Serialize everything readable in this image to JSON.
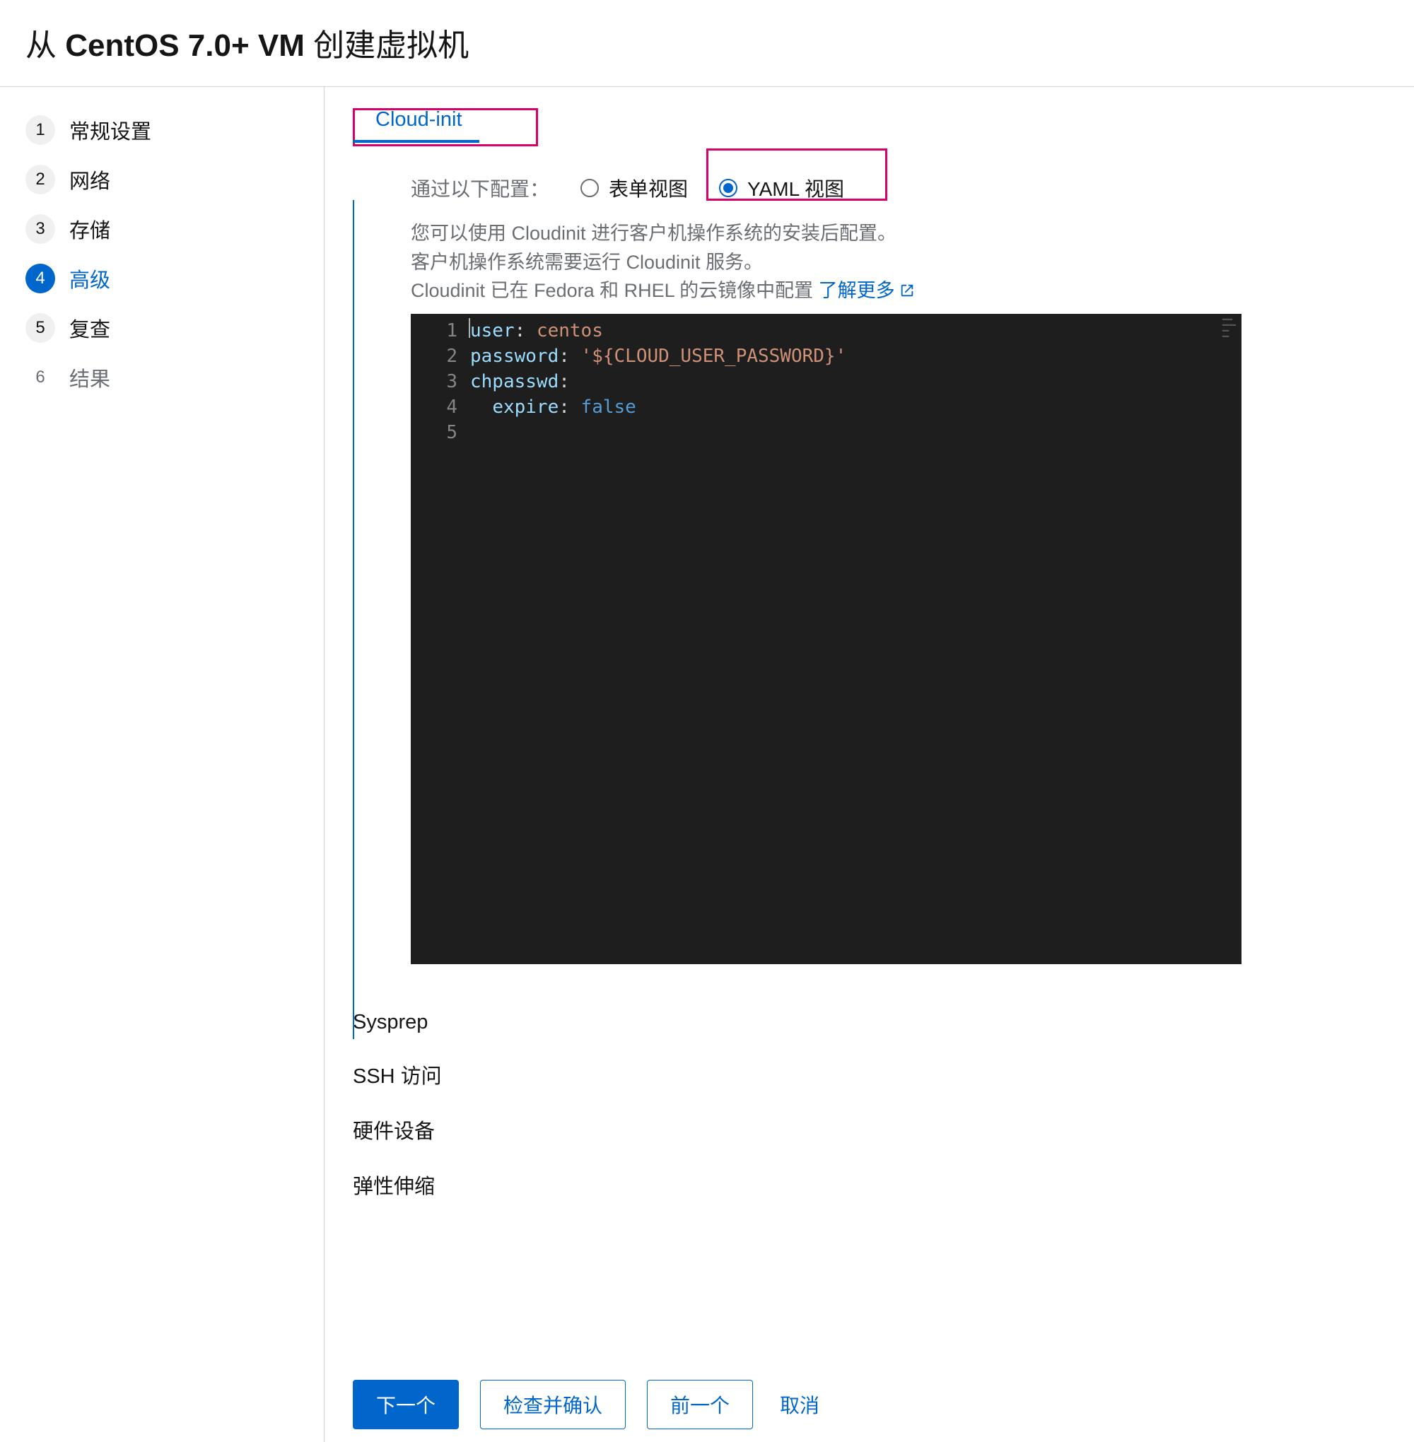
{
  "header": {
    "title_prefix": "从 ",
    "title_bold": "CentOS 7.0+ VM",
    "title_suffix": " 创建虚拟机"
  },
  "steps": [
    {
      "num": "1",
      "label": "常规设置",
      "state": "done"
    },
    {
      "num": "2",
      "label": "网络",
      "state": "done"
    },
    {
      "num": "3",
      "label": "存储",
      "state": "done"
    },
    {
      "num": "4",
      "label": "高级",
      "state": "active"
    },
    {
      "num": "5",
      "label": "复查",
      "state": "done"
    },
    {
      "num": "6",
      "label": "结果",
      "state": "future"
    }
  ],
  "tab": {
    "cloud_init": "Cloud-init"
  },
  "config": {
    "label": "通过以下配置：",
    "form_view": "表单视图",
    "yaml_view": "YAML 视图"
  },
  "description": {
    "line1": "您可以使用 Cloudinit 进行客户机操作系统的安装后配置。",
    "line2": "客户机操作系统需要运行 Cloudinit 服务。",
    "line3_prefix": "Cloudinit 已在 Fedora 和 RHEL 的云镜像中配置 ",
    "learn_more": "了解更多"
  },
  "editor": {
    "gutter": [
      "1",
      "2",
      "3",
      "4",
      "5"
    ],
    "lines": {
      "l1_key": "user",
      "l1_val": "centos",
      "l2_key": "password",
      "l2_val": "'${CLOUD_USER_PASSWORD}'",
      "l3_key": "chpasswd",
      "l4_key": "expire",
      "l4_val": "false"
    }
  },
  "sections": {
    "sysprep": "Sysprep",
    "ssh": "SSH 访问",
    "hardware": "硬件设备",
    "autoscale": "弹性伸缩"
  },
  "footer": {
    "next": "下一个",
    "check": "检查并确认",
    "prev": "前一个",
    "cancel": "取消"
  }
}
